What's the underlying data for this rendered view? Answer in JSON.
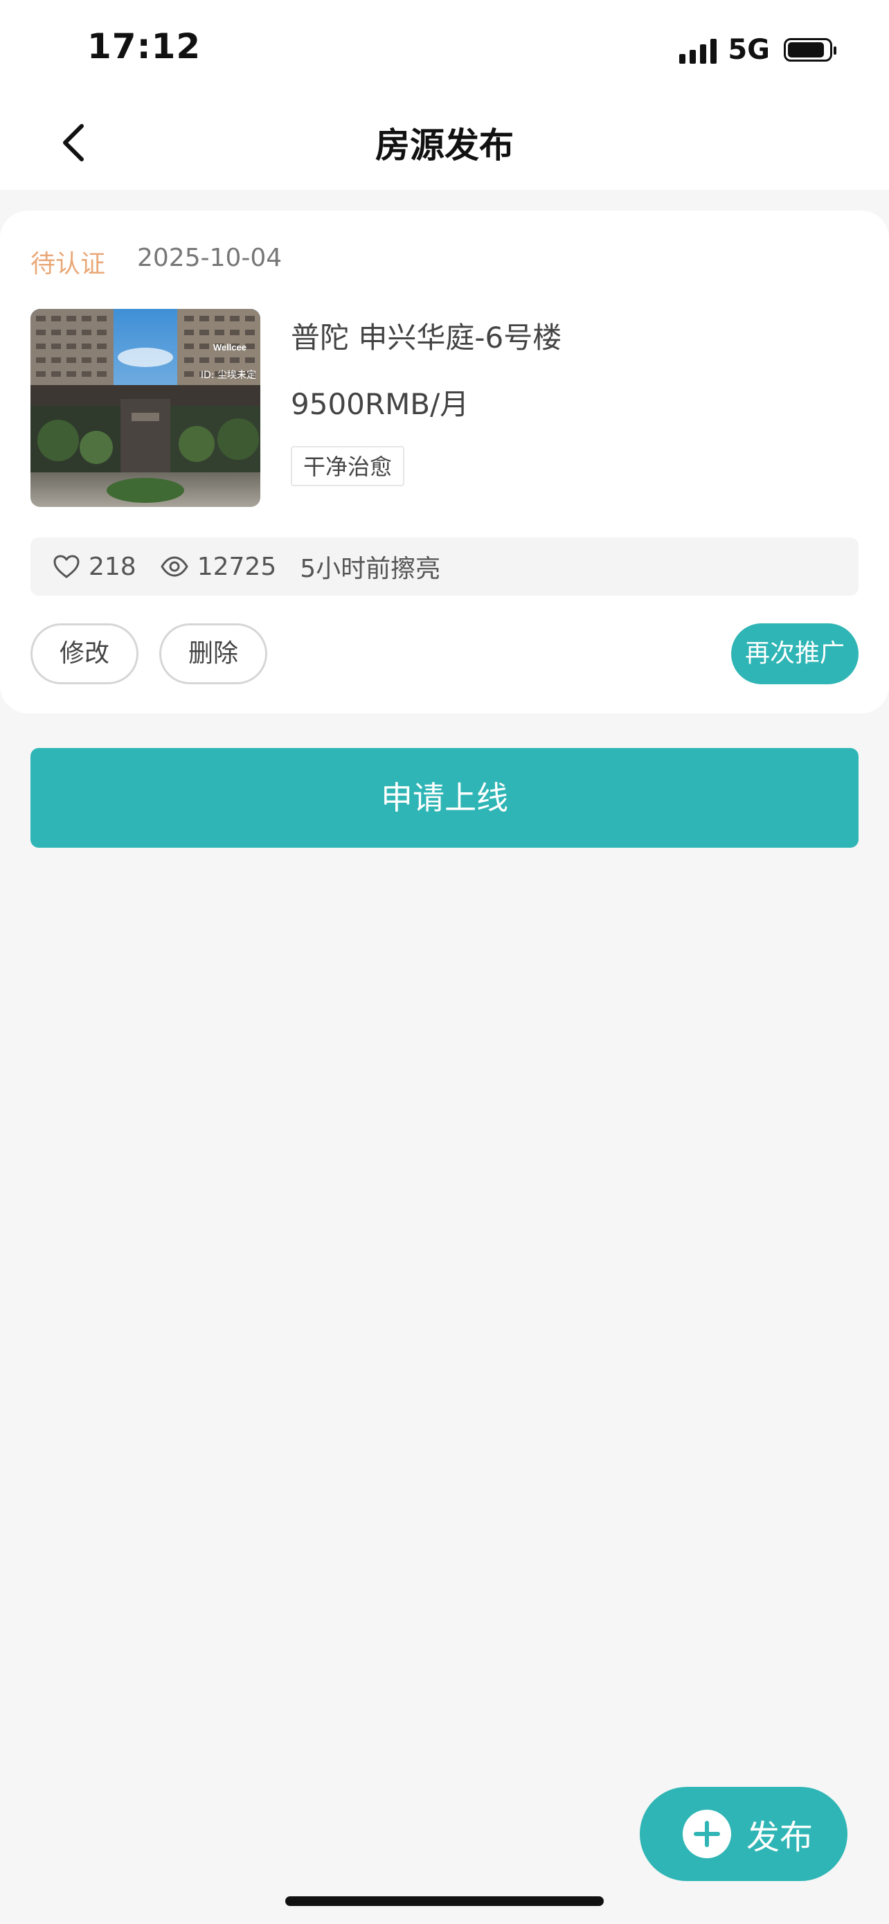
{
  "status_bar": {
    "time": "17:12",
    "network": "5G",
    "battery_level": 0.9
  },
  "nav": {
    "title": "房源发布",
    "back_icon": "chevron-left-icon"
  },
  "listing": {
    "status": "待认证",
    "date": "2025-10-04",
    "title": "普陀 申兴华庭-6号楼",
    "price": "9500RMB/月",
    "tag": "干净治愈",
    "photo_overlay": {
      "brand": "Wellcee",
      "text": "ID: 尘埃未定"
    },
    "stats": {
      "likes": "218",
      "views": "12725",
      "refreshed": "5小时前擦亮"
    },
    "actions": {
      "edit": "修改",
      "delete": "删除",
      "promote": "再次推广"
    }
  },
  "apply_button": "申请上线",
  "publish_fab": "发布",
  "colors": {
    "accent": "#2fb5b5",
    "pending": "#e9a878",
    "background": "#f6f6f6"
  }
}
